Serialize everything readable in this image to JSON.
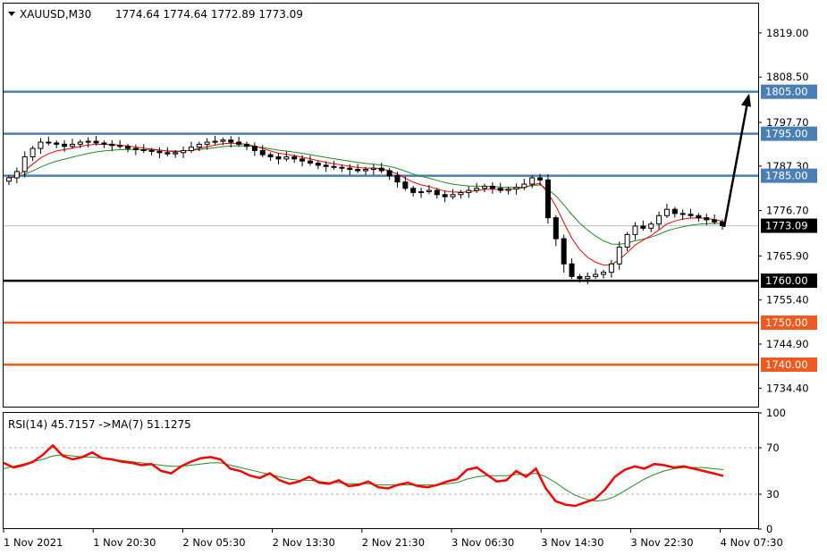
{
  "header": {
    "symbol": "XAUUSD,M30",
    "ohlc": "1774.64 1774.64 1772.89 1773.09"
  },
  "chart_data": [
    {
      "type": "candlestick",
      "title": "XAUUSD,M30",
      "ylim": [
        1730,
        1826
      ],
      "yticks": [
        1819.0,
        1808.5,
        1797.7,
        1787.3,
        1776.7,
        1765.9,
        1755.4,
        1744.9,
        1734.4
      ],
      "ytick_labels": [
        "1819.00",
        "1808.50",
        "1797.70",
        "1787.30",
        "1776.70",
        "1765.90",
        "1755.40",
        "1744.90",
        "1734.40"
      ],
      "current_price": 1773.09,
      "current_price_label": "1773.09",
      "levels": [
        {
          "value": 1805.0,
          "label": "1805.00",
          "color": "#4a7fb5"
        },
        {
          "value": 1795.0,
          "label": "1795.00",
          "color": "#4a7fb5"
        },
        {
          "value": 1785.0,
          "label": "1785.00",
          "color": "#4a7fb5"
        },
        {
          "value": 1760.0,
          "label": "1760.00",
          "color": "#000000"
        },
        {
          "value": 1750.0,
          "label": "1750.00",
          "color": "#f05a1e"
        },
        {
          "value": 1740.0,
          "label": "1740.00",
          "color": "#f05a1e"
        }
      ],
      "projection": {
        "from": 1772.8,
        "to": 1805.0
      },
      "closes": [
        1784.5,
        1786.0,
        1789.5,
        1791.5,
        1793.0,
        1792.8,
        1792.5,
        1792.0,
        1792.5,
        1793.0,
        1793.2,
        1792.8,
        1792.5,
        1792.2,
        1792.0,
        1791.5,
        1791.2,
        1791.0,
        1790.8,
        1790.5,
        1790.2,
        1790.5,
        1791.0,
        1791.8,
        1792.5,
        1793.0,
        1793.2,
        1793.5,
        1793.0,
        1792.5,
        1792.0,
        1791.0,
        1790.0,
        1789.5,
        1789.0,
        1789.5,
        1789.0,
        1788.5,
        1788.0,
        1787.5,
        1787.2,
        1787.0,
        1786.8,
        1786.5,
        1786.2,
        1786.5,
        1786.8,
        1786.2,
        1785.0,
        1783.5,
        1782.0,
        1781.0,
        1781.2,
        1781.5,
        1780.5,
        1780.0,
        1780.5,
        1781.0,
        1781.5,
        1782.0,
        1782.5,
        1782.0,
        1781.5,
        1781.8,
        1782.2,
        1783.0,
        1784.5,
        1784.0,
        1775.0,
        1770.0,
        1764.0,
        1761.0,
        1760.5,
        1761.0,
        1761.5,
        1762.0,
        1764.0,
        1768.0,
        1771.0,
        1773.0,
        1772.5,
        1773.5,
        1775.5,
        1777.0,
        1776.0,
        1775.8,
        1775.5,
        1775.0,
        1774.5,
        1774.0,
        1773.09
      ],
      "x_labels": [
        "1 Nov 2021",
        "1 Nov 20:30",
        "2 Nov 05:30",
        "2 Nov 13:30",
        "2 Nov 21:30",
        "3 Nov 06:30",
        "3 Nov 14:30",
        "3 Nov 22:30",
        "4 Nov 07:30"
      ]
    },
    {
      "type": "line",
      "title": "RSI(14) 45.7157 ->MA(7) 51.1275",
      "ylim": [
        0,
        100
      ],
      "yticks": [
        100,
        70,
        30,
        0
      ],
      "ytick_labels": [
        "100",
        "70",
        "30",
        "0"
      ],
      "levels": [
        70,
        30
      ],
      "series": [
        {
          "color": "#ff0000",
          "values": [
            57,
            53,
            55,
            58,
            64,
            72,
            63,
            60,
            62,
            66,
            61,
            60,
            58,
            57,
            55,
            56,
            50,
            48,
            54,
            58,
            61,
            62,
            60,
            52,
            50,
            46,
            44,
            48,
            42,
            39,
            41,
            45,
            40,
            39,
            42,
            37,
            38,
            41,
            36,
            35,
            38,
            40,
            37,
            36,
            38,
            41,
            43,
            51,
            53,
            47,
            41,
            42,
            50,
            45,
            52,
            35,
            24,
            21,
            20,
            23,
            26,
            34,
            45,
            51,
            54,
            52,
            56,
            55,
            53,
            54,
            52,
            50,
            48,
            45.7157
          ]
        },
        {
          "color": "#228b22",
          "values": [
            52,
            54,
            56,
            58,
            60,
            63,
            64,
            63,
            62,
            62,
            61,
            60,
            59,
            58,
            57,
            56,
            55,
            54,
            54,
            55,
            56,
            57,
            57,
            55,
            53,
            51,
            49,
            47,
            45,
            43,
            42,
            42,
            41,
            40,
            40,
            39,
            39,
            39,
            38,
            38,
            38,
            38,
            38,
            38,
            38,
            39,
            40,
            43,
            45,
            46,
            46,
            46,
            47,
            47,
            48,
            45,
            40,
            34,
            29,
            26,
            24,
            25,
            28,
            33,
            38,
            43,
            47,
            50,
            52,
            53,
            53,
            53,
            52,
            51.1275
          ]
        }
      ]
    }
  ]
}
